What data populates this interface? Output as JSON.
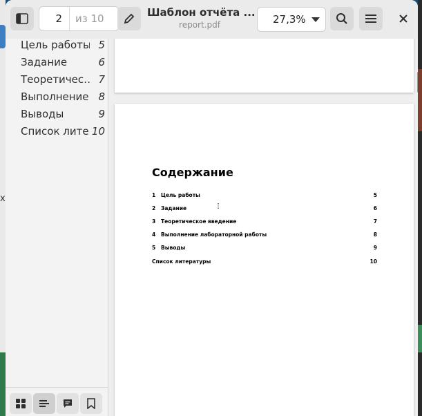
{
  "header": {
    "page_number": "2",
    "page_of": "из 10",
    "doc_title": "Шаблон отчёта ...",
    "doc_filename": "report.pdf",
    "zoom": "27,3%"
  },
  "sidebar": {
    "outline": [
      {
        "label": "Цель работы",
        "page": "5"
      },
      {
        "label": "Задание",
        "page": "6"
      },
      {
        "label": "Теоретичес…",
        "page": "7"
      },
      {
        "label": "Выполнение…",
        "page": "8"
      },
      {
        "label": "Выводы",
        "page": "9"
      },
      {
        "label": "Список лите…",
        "page": "10"
      }
    ]
  },
  "document": {
    "heading": "Содержание",
    "rows": [
      {
        "num": "1",
        "label": "Цель работы",
        "page": "5"
      },
      {
        "num": "2",
        "label": "Задание",
        "page": "6"
      },
      {
        "num": "3",
        "label": "Теоретическое введение",
        "page": "7"
      },
      {
        "num": "4",
        "label": "Выполнение лабораторной работы",
        "page": "8"
      },
      {
        "num": "5",
        "label": "Выводы",
        "page": "9"
      },
      {
        "num": "",
        "label": "Список литературы",
        "page": "10"
      }
    ]
  },
  "icons": {
    "sidebar_toggle": "sidebar-toggle-icon",
    "annotate": "pencil-icon",
    "search": "search-icon",
    "menu": "hamburger-menu-icon",
    "close": "close-icon",
    "thumbnails": "grid-icon",
    "outline": "outline-icon",
    "annotations": "comment-icon",
    "bookmarks": "bookmark-icon"
  }
}
